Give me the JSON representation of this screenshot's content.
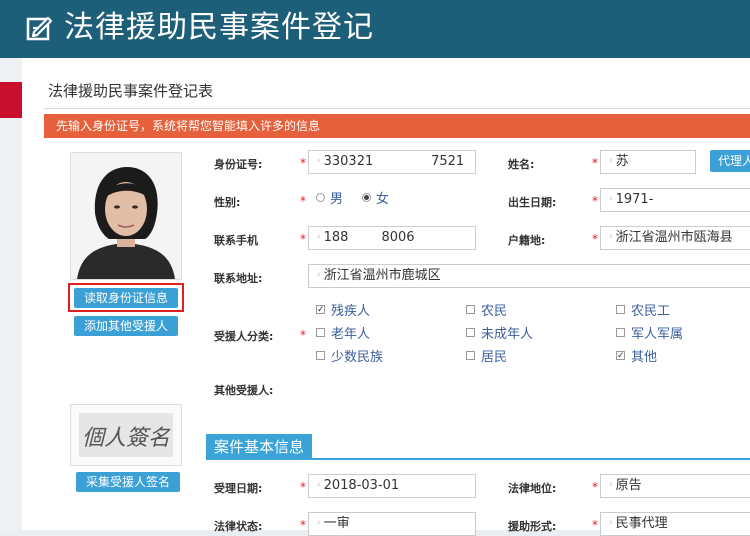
{
  "app": {
    "title": "法律援助民事案件登记",
    "form_title": "法律援助民事案件登记表",
    "notice": "先输入身份证号，系统将帮您智能填入许多的信息"
  },
  "left": {
    "read_id_button": "读取身份证信息",
    "add_other_button": "添加其他受援人",
    "collect_signature_button": "采集受援人签名",
    "signature_text": "個人簽名"
  },
  "form": {
    "id_label": "身份证号:",
    "id_value": "330321              7521",
    "name_label": "姓名:",
    "name_value": "苏",
    "agent_button": "代理人",
    "gender_label": "性别:",
    "gender_options": [
      {
        "label": "男",
        "selected": false
      },
      {
        "label": "女",
        "selected": true
      }
    ],
    "birth_label": "出生日期:",
    "birth_value": "1971-",
    "phone_label": "联系手机",
    "phone_value": "188        8006",
    "hukou_label": "户籍地:",
    "hukou_value": "浙江省温州市瓯海县",
    "address_label": "联系地址:",
    "address_value": "浙江省温州市鹿城区",
    "category_label": "受援人分类:",
    "categories": [
      {
        "label": "残疾人",
        "checked": true
      },
      {
        "label": "农民",
        "checked": false
      },
      {
        "label": "农民工",
        "checked": false
      },
      {
        "label": "老年人",
        "checked": false
      },
      {
        "label": "未成年人",
        "checked": false
      },
      {
        "label": "军人军属",
        "checked": false
      },
      {
        "label": "少数民族",
        "checked": false
      },
      {
        "label": "居民",
        "checked": false
      },
      {
        "label": "其他",
        "checked": true
      }
    ],
    "other_label": "其他受援人:",
    "required_mark": "*"
  },
  "case": {
    "section_title": "案件基本信息",
    "accept_date_label": "受理日期:",
    "accept_date_value": "2018-03-01",
    "legal_status_label": "法律地位:",
    "legal_status_value": "原告",
    "legal_state_label": "法律状态:",
    "legal_state_value": "一审",
    "aid_form_label": "援助形式:",
    "aid_form_value": "民事代理"
  },
  "colors": {
    "header": "#1d5f78",
    "accent": "#3aa3d8",
    "notice": "#e5603b",
    "required": "#e02020"
  }
}
